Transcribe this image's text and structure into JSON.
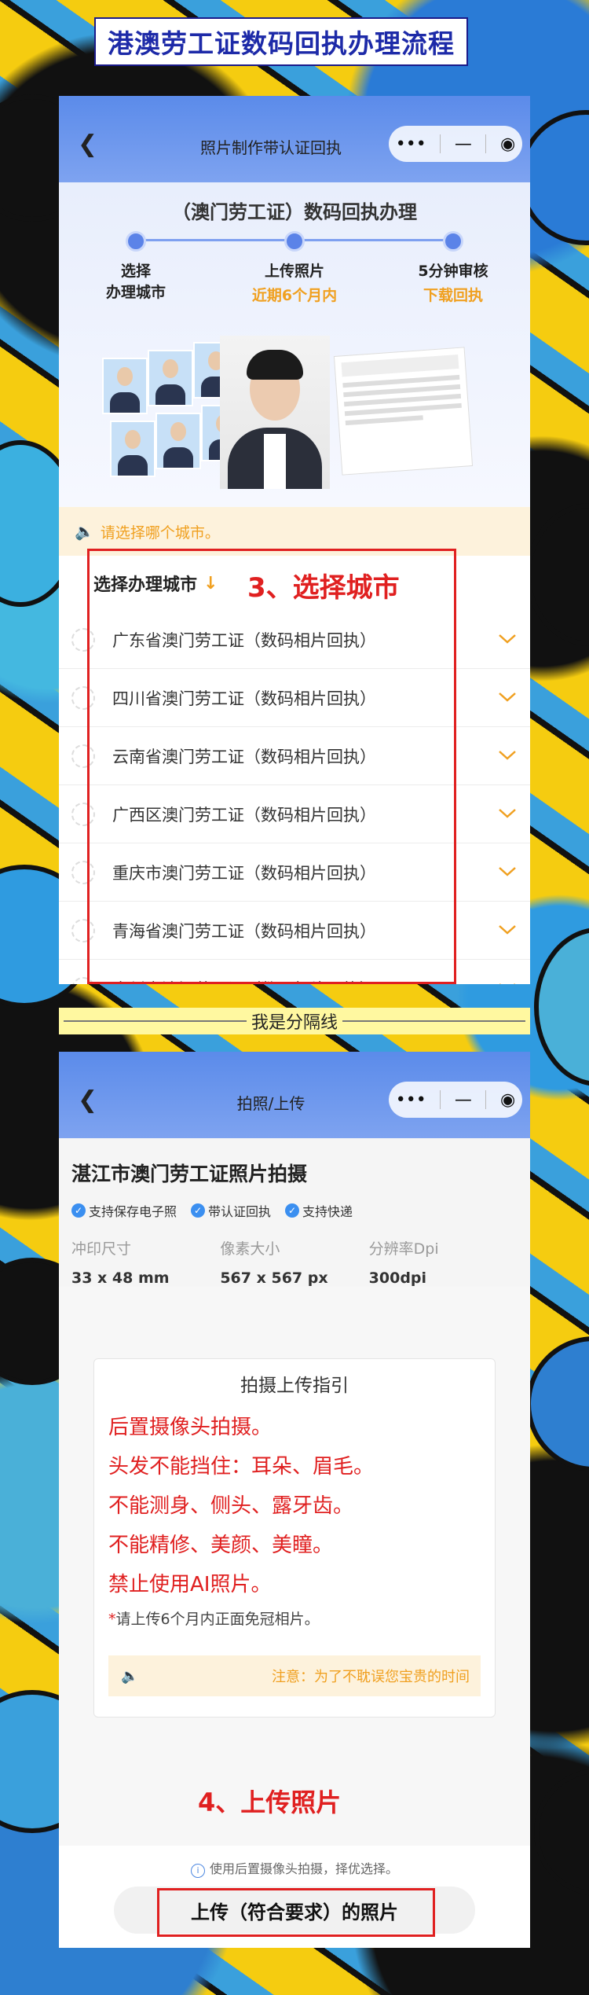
{
  "header": {
    "title": "港澳劳工证数码回执办理流程"
  },
  "screen1": {
    "nav": {
      "title": "照片制作带认证回执",
      "menu": "•••",
      "minimize": "—",
      "record": "◉"
    },
    "steps_title": "（澳门劳工证）数码回执办理",
    "steps": [
      {
        "line1": "选择",
        "line2": "办理城市",
        "accent": false
      },
      {
        "line1": "上传照片",
        "line2": "近期6个月内",
        "accent": true
      },
      {
        "line1": "5分钟审核",
        "line2": "下载回执",
        "accent": true
      }
    ],
    "notice": "请选择哪个城市。",
    "city_header": "选择办理城市",
    "city_header_arrow": "↓",
    "cities": [
      "广东省澳门劳工证（数码相片回执）",
      "四川省澳门劳工证（数码相片回执）",
      "云南省澳门劳工证（数码相片回执）",
      "广西区澳门劳工证（数码相片回执）",
      "重庆市澳门劳工证（数码相片回执）",
      "青海省澳门劳工证（数码相片回执）",
      "贵州省澳门劳工证（数码相片回执）"
    ],
    "annotation": "3、选择城市"
  },
  "divider": "我是分隔线",
  "screen2": {
    "nav": {
      "title": "拍照/上传",
      "menu": "•••",
      "minimize": "—",
      "record": "◉"
    },
    "heading": "湛江市澳门劳工证照片拍摄",
    "tags": [
      "支持保存电子照",
      "带认证回执",
      "支持快递"
    ],
    "specs": [
      {
        "label": "冲印尺寸",
        "value": "33 x 48 mm"
      },
      {
        "label": "像素大小",
        "value": "567 x 567 px"
      },
      {
        "label": "分辨率Dpi",
        "value": "300dpi"
      }
    ],
    "guide": {
      "title": "拍摄上传指引",
      "rules": [
        "后置摄像头拍摄。",
        "头发不能挡住：耳朵、眉毛。",
        "不能测身、侧头、露牙齿。",
        "不能精修、美颜、美瞳。",
        "禁止使用AI照片。"
      ],
      "note_star": "*",
      "note": "请上传6个月内正面免冠相片。",
      "warning": "注意：为了不耽误您宝贵的时间"
    },
    "annotation": "4、上传照片",
    "tip": "使用后置摄像头拍摄，择优选择。",
    "upload_button": "上传（符合要求）的照片"
  }
}
